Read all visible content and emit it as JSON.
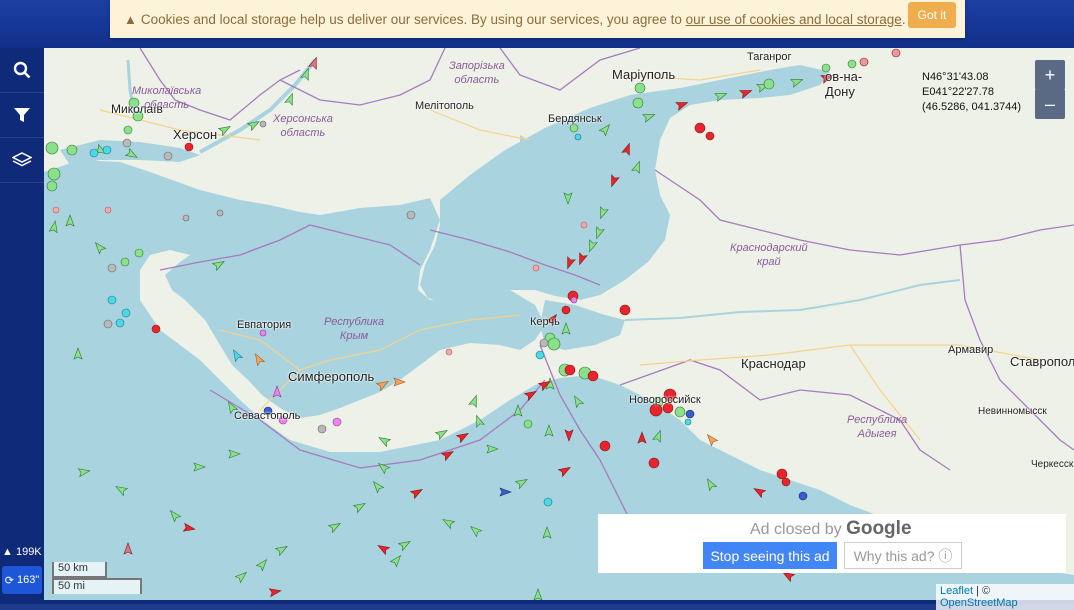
{
  "cookie": {
    "text": "Cookies and local storage help us deliver our services. By using our services, you agree to",
    "link": "our use of cookies and local storage",
    "after": ".",
    "button": "Got it"
  },
  "sidebar": {
    "items": [
      {
        "icon": "search-icon"
      },
      {
        "icon": "filter-icon"
      },
      {
        "icon": "layers-icon"
      }
    ],
    "vessel_count": "199K",
    "refresh_label": "163\""
  },
  "coords": {
    "lat": "N46°31'43.08",
    "lon": "E041°22'27.78",
    "decimal": "(46.5286, 041.3744)"
  },
  "zoom": {
    "in": "+",
    "out": "–"
  },
  "ad": {
    "title": "Ad closed by",
    "brand": "Google",
    "stop": "Stop seeing this ad",
    "why": "Why this ad? ⓘ"
  },
  "scale": {
    "km": "50 km",
    "mi": "50 mi"
  },
  "attribution": {
    "leaflet": "Leaflet",
    "sep": " | © ",
    "osm": "OpenStreetMap"
  },
  "labels": [
    {
      "name": "label-mykolaivska",
      "text": "Миколаївська\nобласть",
      "kind": "region"
    },
    {
      "name": "label-mykolaiv",
      "text": "Миколаїв",
      "kind": "city"
    },
    {
      "name": "label-kherson",
      "text": "Херсон",
      "kind": "city"
    },
    {
      "name": "label-khersonska",
      "text": "Херсонська\nобласть",
      "kind": "region"
    },
    {
      "name": "label-zaporizka",
      "text": "Запорізька\nобласть",
      "kind": "region"
    },
    {
      "name": "label-melitopol",
      "text": "Мелітополь",
      "kind": "city"
    },
    {
      "name": "label-berdiansk",
      "text": "Бердянськ",
      "kind": "city"
    },
    {
      "name": "label-mariupol",
      "text": "Маріуполь",
      "kind": "city"
    },
    {
      "name": "label-tahanrih",
      "text": "Таганрог",
      "kind": "city"
    },
    {
      "name": "label-rostov",
      "text": "ов-на-\nДону",
      "kind": "city"
    },
    {
      "name": "label-krasnodarskiy",
      "text": "Краснодарский\nкрай",
      "kind": "region"
    },
    {
      "name": "label-yevpatoria",
      "text": "Евпатория",
      "kind": "city"
    },
    {
      "name": "label-krym",
      "text": "Республика\nКрым",
      "kind": "region"
    },
    {
      "name": "label-simferopol",
      "text": "Симферополь",
      "kind": "city"
    },
    {
      "name": "label-kerch",
      "text": "Керчь",
      "kind": "city"
    },
    {
      "name": "label-krasnodar",
      "text": "Краснодар",
      "kind": "city"
    },
    {
      "name": "label-armavir",
      "text": "Армавир",
      "kind": "city"
    },
    {
      "name": "label-stavropol",
      "text": "Ставрополь",
      "kind": "city"
    },
    {
      "name": "label-novorossiysk",
      "text": "Новороссийск",
      "kind": "city"
    },
    {
      "name": "label-sevastopol",
      "text": "Севастополь",
      "kind": "city"
    },
    {
      "name": "label-nevinnomyssk",
      "text": "Невинномысск",
      "kind": "city"
    },
    {
      "name": "label-adygea",
      "text": "Республика\nАдыгея",
      "kind": "region"
    },
    {
      "name": "label-cherkessk",
      "text": "Черкесск",
      "kind": "city"
    }
  ],
  "colors": {
    "sea": "#a9d3df",
    "land": "#eef1e8",
    "cargo": "#8be08b",
    "tanker": "#e8242c",
    "passenger": "#3a5ccf",
    "special": "#4fd7e6",
    "unknown": "#b9b9b9"
  }
}
